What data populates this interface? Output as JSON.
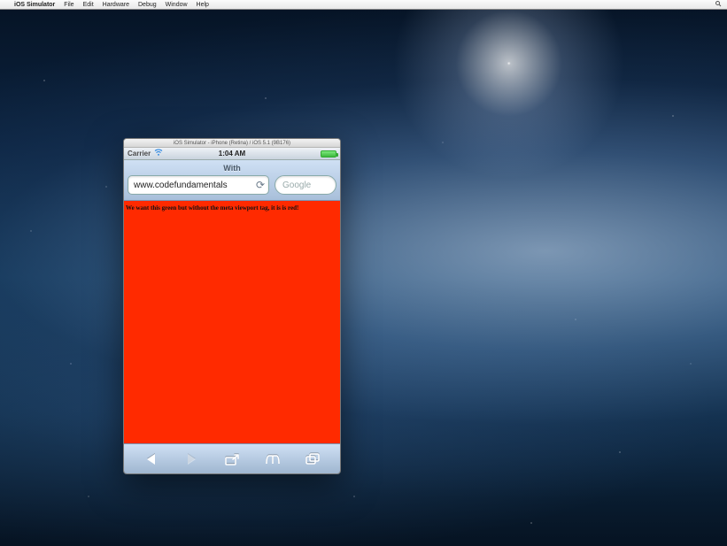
{
  "mac_menubar": {
    "apple": "",
    "app_name": "iOS Simulator",
    "items": [
      "File",
      "Edit",
      "Hardware",
      "Debug",
      "Window",
      "Help"
    ]
  },
  "simulator": {
    "window_title": "iOS Simulator - iPhone (Retina) / iOS 5.1 (9B176)"
  },
  "ios": {
    "carrier": "Carrier",
    "time": "1:04 AM"
  },
  "safari": {
    "page_title": "With",
    "url": "www.codefundamentals",
    "search_placeholder": "Google"
  },
  "page_content": {
    "body_text": "We want this green but without the meta viewport tag, it is is red!"
  },
  "icons": {
    "reload": "⟳",
    "wifi": "⦿"
  }
}
